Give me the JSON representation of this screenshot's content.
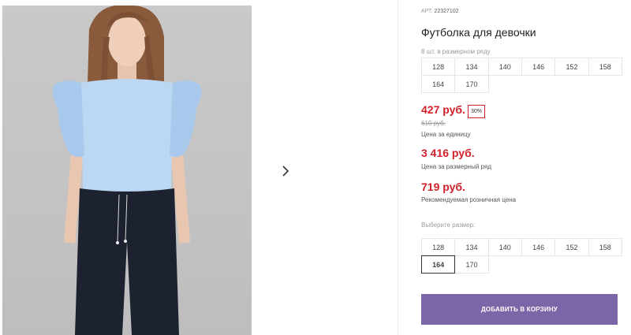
{
  "product": {
    "sku_label": "АРТ.",
    "sku_value": "22327102",
    "title": "Футболка для девочки",
    "pack_note": "8 шт. в размерном ряду",
    "pack_sizes": [
      "128",
      "134",
      "140",
      "146",
      "152",
      "158",
      "164",
      "170"
    ],
    "price": "427 руб.",
    "discount": "30%",
    "old_price": "610 руб.",
    "price_unit_note": "Цена за единицу",
    "pack_price": "3 416 руб.",
    "pack_price_note": "Цена за размерный ряд",
    "retail_price": "719 руб.",
    "retail_price_note": "Рекомендуемая розничная цена",
    "choose_size_label": "Выберите размер:",
    "size_options": [
      "128",
      "134",
      "140",
      "146",
      "152",
      "158",
      "164",
      "170"
    ],
    "selected_size": "164",
    "add_to_cart_label": "ДОБАВИТЬ В КОРЗИНУ"
  },
  "gallery": {
    "next_icon": "chevron-right-icon"
  },
  "colors": {
    "accent": "#7b67a7",
    "price": "#d0202a"
  }
}
